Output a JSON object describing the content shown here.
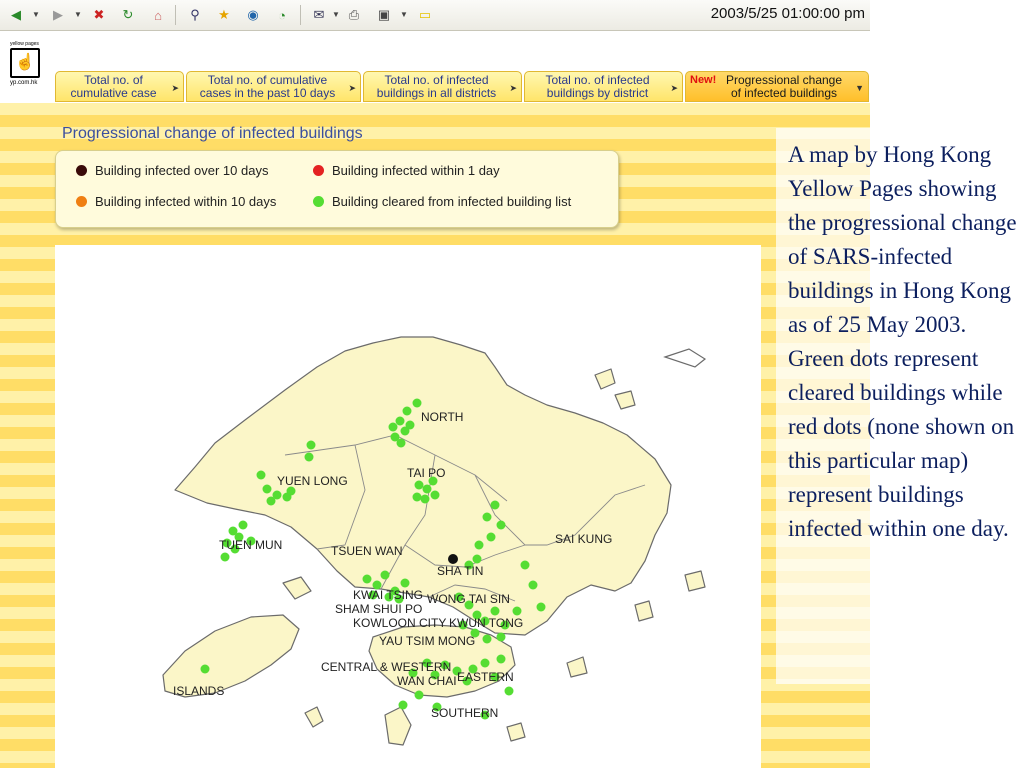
{
  "browser": {
    "datetime": "2003/5/25 01:00:00 pm",
    "toolbar_icons": [
      "back-icon",
      "forward-icon",
      "stop-icon",
      "refresh-icon",
      "home-icon",
      "search-icon",
      "favorites-icon",
      "media-icon",
      "history-icon",
      "mail-icon",
      "print-icon",
      "edit-icon",
      "discuss-icon"
    ]
  },
  "logo": {
    "top_text": "yellow pages",
    "bottom_text": "yp.com.hk"
  },
  "tabs": [
    {
      "label": "Total no. of\ncumulative case"
    },
    {
      "label": "Total no. of cumulative\ncases in the past 10 days"
    },
    {
      "label": "Total no. of infected\nbuildings in all districts"
    },
    {
      "label": "Total no. of infected\nbuildings by district"
    },
    {
      "badge": "New!",
      "label": "Progressional change\nof infected buildings",
      "active": true
    }
  ],
  "heading": "Progressional change of infected buildings",
  "legend": [
    {
      "label": "Building infected over 10 days",
      "color": "#3a0a08"
    },
    {
      "label": "Building infected within 1 day",
      "color": "#e42222"
    },
    {
      "label": "Building infected within 10 days",
      "color": "#ef7f12"
    },
    {
      "label": "Building cleared from infected building list",
      "color": "#55dd33"
    }
  ],
  "map": {
    "land_color": "#fbf6c8",
    "border_color": "#6b6b6b",
    "districts": {
      "north": "NORTH",
      "yuen_long": "YUEN LONG",
      "tai_po": "TAI PO",
      "tuen_mun": "TUEN MUN",
      "tsuen_wan": "TSUEN WAN",
      "sai_kung": "SAI KUNG",
      "sha_tin": "SHA TIN",
      "kwai_tsing": "KWAI TSING",
      "wong_tai_sin": "WONG TAI SIN",
      "sham_shui_po": "SHAM SHUI PO",
      "kowloon_city": "KOWLOON CITY",
      "kwun_tong": "KWUN TONG",
      "yau_tsim_mong": "YAU TSIM MONG",
      "central_western": "CENTRAL & WESTERN",
      "wan_chai": "WAN CHAI",
      "eastern": "EASTERN",
      "islands": "ISLANDS",
      "southern": "SOUTHERN"
    }
  },
  "caption": "A map by Hong Kong Yellow Pages showing the progressional change of SARS-infected buildings in Hong Kong as of 25 May 2003. Green dots represent cleared buildings while red dots (none shown on this particular map) represent buildings infected within one day."
}
